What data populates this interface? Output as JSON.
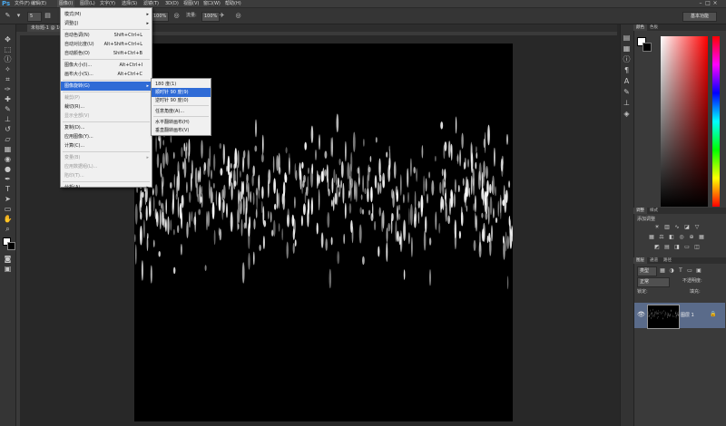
{
  "app": {
    "logo": "Ps"
  },
  "menubar": {
    "items": [
      "文件(F)",
      "编辑(E)",
      "图像(I)",
      "图层(L)",
      "文字(Y)",
      "选择(S)",
      "滤镜(T)",
      "3D(D)",
      "视图(V)",
      "窗口(W)",
      "帮助(H)"
    ],
    "window_controls": [
      "–",
      "□",
      "×"
    ]
  },
  "options": {
    "brush_size": "5",
    "mode_value": "正常",
    "opacity_label": "不透明度:",
    "opacity_value": "100%",
    "flow_label": "流量:",
    "flow_value": "100%",
    "workspace": "基本功能"
  },
  "document": {
    "tab_title": "未标题-1 @ 100% (图层 1, RGB/8)"
  },
  "image_menu": {
    "items": [
      {
        "label": "模式(M)",
        "shortcut": "",
        "submenu": true,
        "disabled": false
      },
      {
        "label": "调整(J)",
        "shortcut": "",
        "submenu": true,
        "disabled": false
      },
      {
        "label": "自动色调(N)",
        "shortcut": "Shift+Ctrl+L",
        "submenu": false,
        "disabled": false
      },
      {
        "label": "自动对比度(U)",
        "shortcut": "Alt+Shift+Ctrl+L",
        "submenu": false,
        "disabled": false
      },
      {
        "label": "自动颜色(O)",
        "shortcut": "Shift+Ctrl+B",
        "submenu": false,
        "disabled": false
      },
      {
        "label": "图像大小(I)...",
        "shortcut": "Alt+Ctrl+I",
        "submenu": false,
        "disabled": false
      },
      {
        "label": "画布大小(S)...",
        "shortcut": "Alt+Ctrl+C",
        "submenu": false,
        "disabled": false
      },
      {
        "label": "图像旋转(G)",
        "shortcut": "",
        "submenu": true,
        "disabled": false,
        "highlight": true
      },
      {
        "label": "裁剪(P)",
        "shortcut": "",
        "submenu": false,
        "disabled": true
      },
      {
        "label": "裁切(R)...",
        "shortcut": "",
        "submenu": false,
        "disabled": false
      },
      {
        "label": "显示全部(V)",
        "shortcut": "",
        "submenu": false,
        "disabled": true
      },
      {
        "label": "复制(D)...",
        "shortcut": "",
        "submenu": false,
        "disabled": false
      },
      {
        "label": "应用图像(Y)...",
        "shortcut": "",
        "submenu": false,
        "disabled": false
      },
      {
        "label": "计算(C)...",
        "shortcut": "",
        "submenu": false,
        "disabled": false
      },
      {
        "label": "变量(B)",
        "shortcut": "",
        "submenu": true,
        "disabled": true
      },
      {
        "label": "应用数据组(L)...",
        "shortcut": "",
        "submenu": false,
        "disabled": true
      },
      {
        "label": "陷印(T)...",
        "shortcut": "",
        "submenu": false,
        "disabled": true
      },
      {
        "label": "分析(A)",
        "shortcut": "",
        "submenu": true,
        "disabled": false
      }
    ]
  },
  "rotate_submenu": {
    "items": [
      {
        "label": "180 度(1)",
        "highlight": false
      },
      {
        "label": "顺时针 90 度(9)",
        "highlight": true
      },
      {
        "label": "逆时针 90 度(0)",
        "highlight": false
      },
      {
        "label": "任意角度(A)...",
        "highlight": false
      },
      {
        "label": "水平翻转画布(H)",
        "highlight": false
      },
      {
        "label": "垂直翻转画布(V)",
        "highlight": false
      }
    ]
  },
  "panels": {
    "color_tabs": [
      "颜色",
      "色板"
    ],
    "adjust_tabs": [
      "调整",
      "样式"
    ],
    "adjust_title": "添加调整",
    "layers_tabs": [
      "图层",
      "通道",
      "路径"
    ],
    "kind_label": "类型",
    "blend_mode": "正常",
    "opacity_label": "不透明度:",
    "lock_label": "锁定:",
    "fill_label": "填充:",
    "layer_name": "图层 1"
  },
  "colors": {
    "menu_highlight": "#2f6bd6",
    "layer_selected": "#5a6b8a",
    "ps_blue": "#4aa6e8"
  }
}
